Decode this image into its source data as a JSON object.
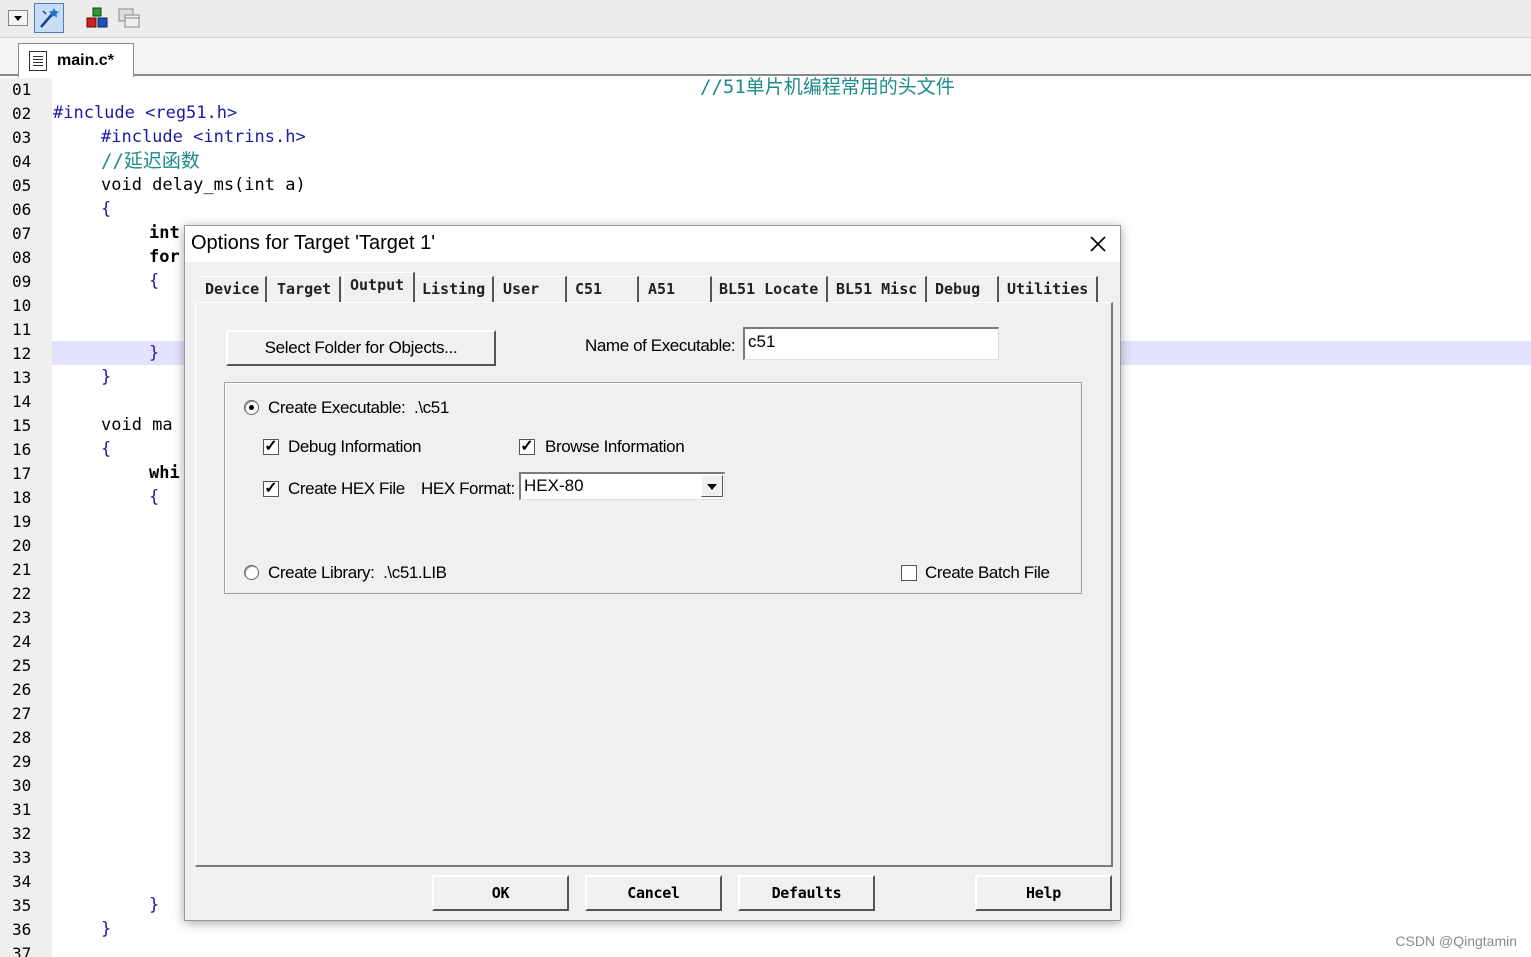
{
  "toolbar": {
    "icons": [
      "dropdown-arrow-icon",
      "target-options-wand-icon",
      "pack-installer-icon",
      "window-layout-icon"
    ]
  },
  "editor_tab": {
    "label": "main.c*"
  },
  "line_numbers": [
    "01",
    "02",
    "03",
    "04",
    "05",
    "06",
    "07",
    "08",
    "09",
    "10",
    "11",
    "12",
    "13",
    "14",
    "15",
    "16",
    "17",
    "18",
    "19",
    "20",
    "21",
    "22",
    "23",
    "24",
    "25",
    "26",
    "27",
    "28",
    "29",
    "30",
    "31",
    "32",
    "33",
    "34",
    "35",
    "36",
    "37"
  ],
  "code": {
    "l1_comment": "//51单片机编程常用的头文件",
    "l2": "#include <reg51.h>",
    "l3": "#include <intrins.h>",
    "l4_comment": "//延迟函数",
    "l5": "void delay_ms(int a)",
    "l6": "{",
    "l7": "int",
    "l8": "for",
    "l9": "{",
    "l12": "}",
    "l13": "}",
    "l15": "void ma",
    "l16": "{",
    "l17": "whi",
    "l18": "{",
    "l35": "}",
    "l36": "}"
  },
  "dialog": {
    "title": "Options for Target 'Target 1'",
    "tabs": [
      "Device",
      "Target",
      "Output",
      "Listing",
      "User",
      "C51",
      "A51",
      "BL51 Locate",
      "BL51 Misc",
      "Debug",
      "Utilities"
    ],
    "active_tab": "Output",
    "select_folder_button": "Select Folder for Objects...",
    "name_of_executable_label": "Name of Executable:",
    "name_of_executable_value": "c51",
    "create_executable_label": "Create Executable:  .\\c51",
    "debug_information_label": "Debug Information",
    "browse_information_label": "Browse Information",
    "create_hex_label": "Create HEX File",
    "hex_format_label": "HEX Format:",
    "hex_format_value": "HEX-80",
    "create_library_label": "Create Library:  .\\c51.LIB",
    "create_batch_label": "Create Batch File",
    "checks": {
      "debug_information": true,
      "browse_information": true,
      "create_hex": true,
      "create_batch": false
    },
    "radio": "create_executable",
    "buttons": {
      "ok": "OK",
      "cancel": "Cancel",
      "defaults": "Defaults",
      "help": "Help"
    }
  },
  "watermark": "CSDN @Qingtamin",
  "colors": {
    "comment": "#1f8a8a",
    "preprocessor": "#1a1aa6",
    "highlight_line": "#e3e3ff",
    "dialog_bg": "#f0f0f0"
  }
}
